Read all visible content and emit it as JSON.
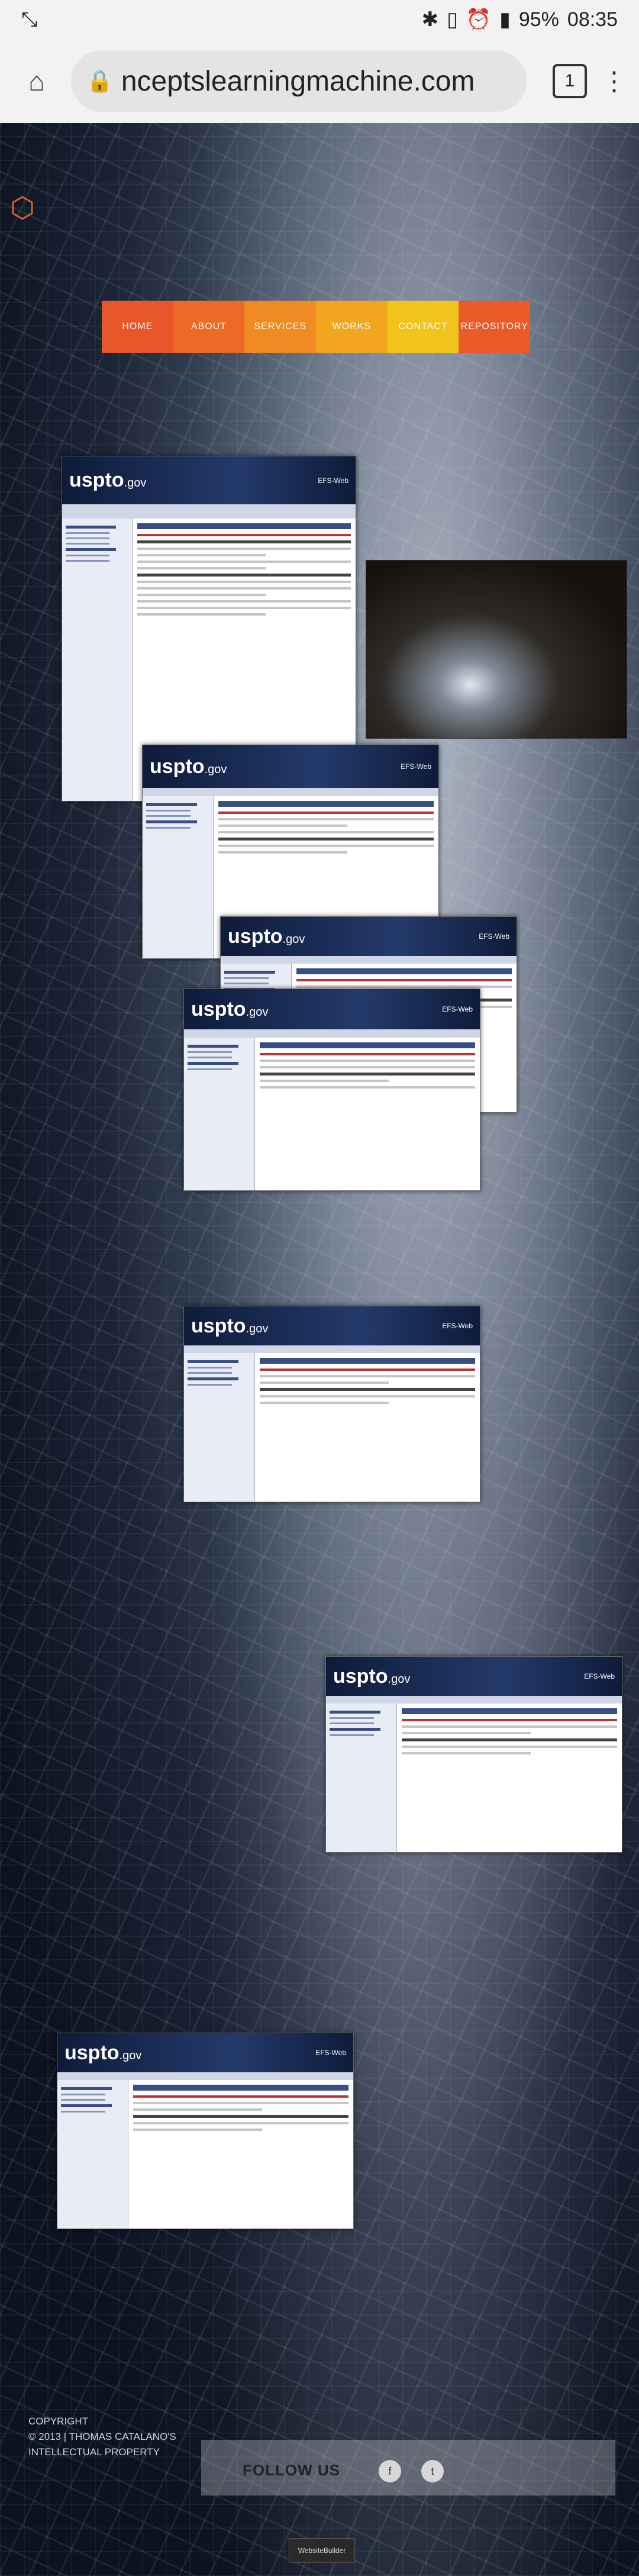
{
  "status_bar": {
    "left_icon": "screenshot-icon",
    "battery": "95%",
    "time": "08:35"
  },
  "browser": {
    "url": "nceptslearningmachine.com",
    "tab_count": "1"
  },
  "nav": {
    "items": [
      {
        "label": "HOME",
        "color": "#e8562a"
      },
      {
        "label": "ABOUT",
        "color": "#ec6a25"
      },
      {
        "label": "SERVICES",
        "color": "#f08a22"
      },
      {
        "label": "WORKS",
        "color": "#f2a51f"
      },
      {
        "label": "CONTACT",
        "color": "#f0c41d"
      },
      {
        "label": "REPOSITORY",
        "color": "#ec5a2a"
      }
    ]
  },
  "uspto_screenshots": [
    {
      "logo": "uspto",
      "logo_suffix": ".gov",
      "tag": "EFS-Web"
    },
    {
      "logo": "uspto",
      "logo_suffix": ".gov",
      "tag": "EFS-Web"
    },
    {
      "logo": "uspto",
      "logo_suffix": ".gov",
      "tag": "EFS-Web"
    },
    {
      "logo": "uspto",
      "logo_suffix": ".gov",
      "tag": "EFS-Web"
    },
    {
      "logo": "uspto",
      "logo_suffix": ".gov",
      "tag": "EFS-Web"
    },
    {
      "logo": "uspto",
      "logo_suffix": ".gov",
      "tag": "EFS-Web"
    },
    {
      "logo": "uspto",
      "logo_suffix": ".gov",
      "tag": "EFS-Web"
    }
  ],
  "footer": {
    "copyright_line1": "COPYRIGHT",
    "copyright_line2": "© 2013 | THOMAS CATALANO'S",
    "copyright_line3": "INTELLECTUAL PROPERTY",
    "follow_label": "FOLLOW US",
    "builder_badge": "WebsiteBuilder"
  }
}
